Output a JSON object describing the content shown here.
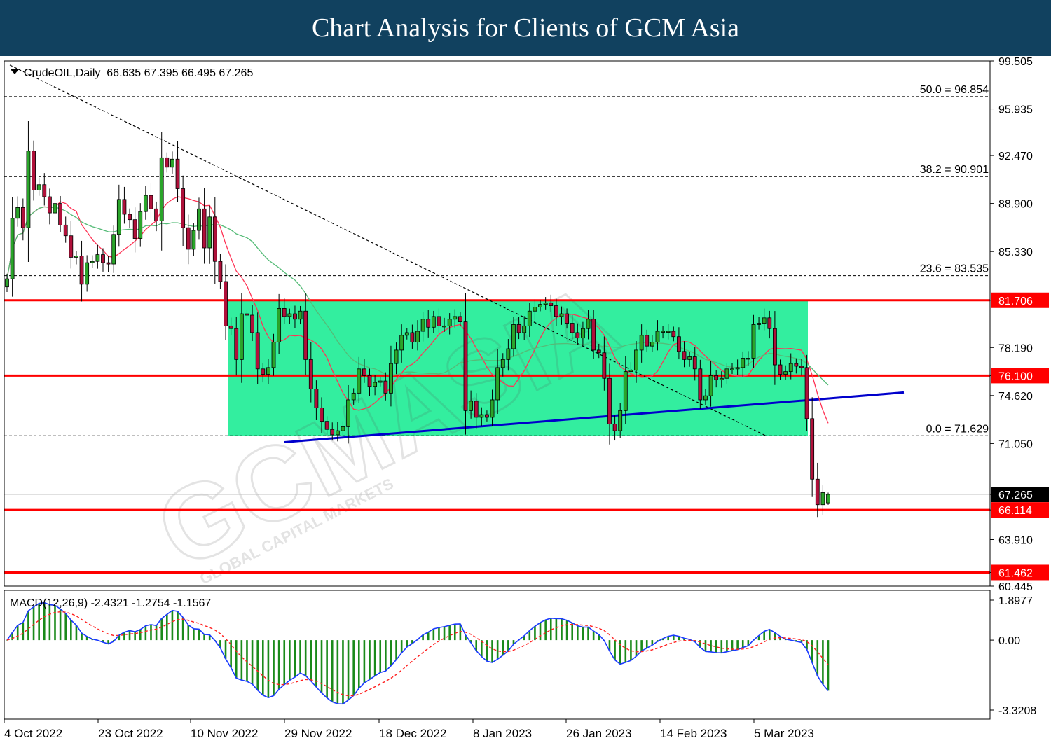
{
  "banner": {
    "title": "Chart Analysis for Clients of GCM Asia"
  },
  "watermark": {
    "brand": "GCMASIA",
    "subtitle": "GLOBAL CAPITAL MARKETS"
  },
  "chart_data": {
    "type": "candlestick",
    "symbol_line": "CrudeOIL,Daily  66.635 67.395 66.495 67.265",
    "ohlc_last": {
      "open": 66.635,
      "high": 67.395,
      "low": 66.495,
      "close": 67.265
    },
    "price_axis": {
      "ylim": [
        60.445,
        99.505
      ],
      "ticks": [
        "99.505",
        "95.935",
        "92.470",
        "88.900",
        "85.330",
        "81.706",
        "78.190",
        "76.100",
        "74.620",
        "71.050",
        "67.265",
        "66.114",
        "63.910",
        "61.462",
        "60.445"
      ]
    },
    "time_axis": {
      "labels": [
        "4 Oct 2022",
        "23 Oct 2022",
        "10 Nov 2022",
        "29 Nov 2022",
        "18 Dec 2022",
        "8 Jan 2023",
        "26 Jan 2023",
        "14 Feb 2023",
        "5 Mar 2023"
      ]
    },
    "fibonacci_levels": [
      {
        "label": "50.0 = 96.854",
        "value": 96.854
      },
      {
        "label": "38.2 = 90.901",
        "value": 90.901
      },
      {
        "label": "23.6 = 83.535",
        "value": 83.535
      },
      {
        "label": "0.0 = 71.629",
        "value": 71.629
      }
    ],
    "horizontal_levels": [
      {
        "label": "81.706",
        "value": 81.706,
        "color": "#ff0000"
      },
      {
        "label": "76.100",
        "value": 76.1,
        "color": "#ff0000"
      },
      {
        "label": "66.114",
        "value": 66.114,
        "color": "#ff0000"
      },
      {
        "label": "61.462",
        "value": 61.462,
        "color": "#ff0000"
      }
    ],
    "current_price": {
      "label": "67.265",
      "value": 67.265
    },
    "consolidation_zone": {
      "from_date": "10 Nov 2022",
      "to_date": "10 Mar 2023",
      "low": 71.629,
      "high": 81.706,
      "color": "#33ee9f"
    },
    "trendline_support": {
      "start": [
        "29 Nov 2022",
        71.15
      ],
      "end": [
        "14 Mar 2023",
        74.85
      ],
      "color": "#0000cc"
    },
    "trendline_resistance_dashed": {
      "start": [
        "4 Oct 2022",
        99.2
      ],
      "end": [
        "8 Mar 2023",
        71.6
      ]
    },
    "candles_close": [
      83.3,
      87.8,
      88.6,
      87.1,
      92.8,
      89.9,
      90.3,
      89.4,
      88.2,
      88.9,
      87.3,
      86.5,
      84.9,
      85.0,
      82.9,
      84.5,
      84.6,
      85.1,
      84.5,
      84.4,
      86.6,
      89.2,
      88.1,
      87.7,
      86.3,
      88.3,
      89.5,
      88.5,
      87.6,
      92.3,
      91.6,
      92.2,
      90.0,
      87.1,
      85.5,
      86.9,
      88.5,
      85.6,
      87.9,
      84.6,
      83.1,
      79.8,
      79.6,
      77.3,
      80.7,
      80.6,
      79.3,
      76.6,
      76.2,
      76.7,
      78.6,
      81.1,
      80.5,
      80.7,
      80.3,
      80.9,
      77.3,
      75.1,
      73.7,
      72.7,
      72.1,
      71.7,
      72.0,
      72.3,
      74.3,
      74.8,
      76.6,
      76.1,
      75.3,
      75.6,
      75.7,
      74.8,
      77.0,
      78.0,
      79.1,
      79.3,
      78.6,
      79.4,
      80.3,
      79.7,
      80.5,
      79.8,
      79.8,
      80.3,
      80.5,
      80.1,
      73.5,
      74.2,
      73.0,
      73.2,
      73.0,
      74.3,
      76.7,
      77.3,
      78.1,
      79.9,
      79.3,
      79.8,
      80.9,
      81.2,
      81.4,
      81.5,
      81.3,
      80.5,
      80.7,
      80.0,
      79.3,
      78.9,
      79.6,
      80.3,
      78.0,
      77.8,
      75.9,
      72.5,
      72.0,
      73.5,
      76.4,
      76.5,
      78.0,
      79.1,
      78.3,
      78.6,
      79.4,
      79.4,
      79.4,
      79.0,
      77.9,
      77.3,
      77.5,
      76.6,
      74.3,
      74.6,
      76.1,
      75.8,
      75.9,
      76.6,
      76.6,
      76.7,
      77.4,
      77.4,
      79.9,
      80.0,
      80.4,
      79.6,
      76.9,
      76.2,
      76.4,
      77.0,
      76.8,
      76.7,
      72.9,
      68.4,
      66.5,
      67.4,
      67.265
    ],
    "sma_fast": {
      "color": "#ff3355"
    },
    "sma_slow": {
      "color": "#55bb77"
    },
    "macd": {
      "label": "MACD(12,26,9) -2.4321 -1.2754 -1.1567",
      "values": {
        "macd": -2.4321,
        "signal": -1.2754,
        "histogram": -1.1567
      },
      "axis_ticks": [
        "1.8977",
        "0.00",
        "-3.3208"
      ],
      "ylim": [
        -3.3208,
        1.8977
      ]
    }
  }
}
